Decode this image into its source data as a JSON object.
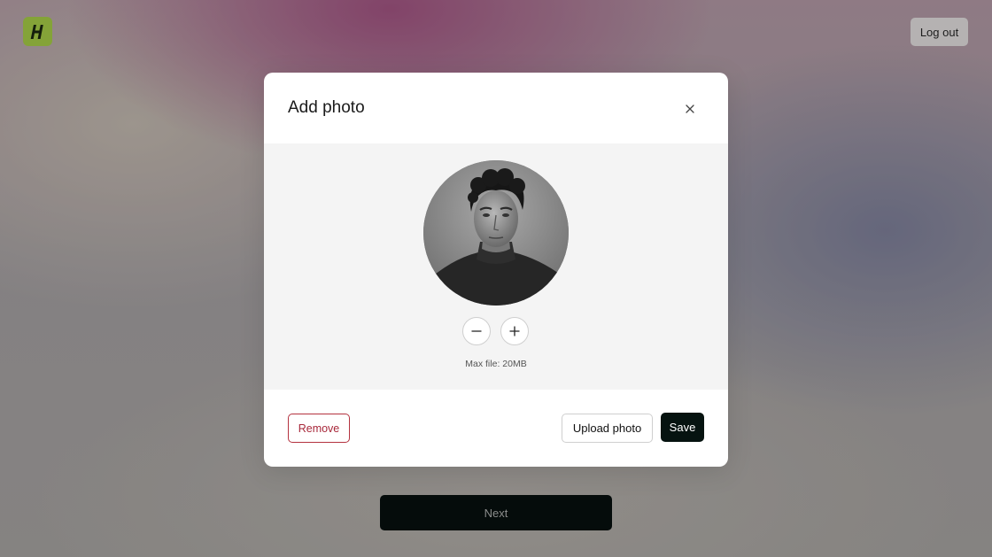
{
  "app": {
    "logo_icon": "brand-logo-icon",
    "brand_color": "#b7e24e"
  },
  "header": {
    "logout_label": "Log out"
  },
  "page": {
    "next_label": "Next"
  },
  "modal": {
    "title": "Add photo",
    "close_icon": "close-icon",
    "avatar_icon": "profile-photo",
    "zoom_out_icon": "minus-icon",
    "zoom_in_icon": "plus-icon",
    "max_file_text": "Max file: 20MB",
    "remove_label": "Remove",
    "upload_label": "Upload photo",
    "save_label": "Save",
    "danger_color": "#b4323f",
    "primary_color": "#061310"
  }
}
